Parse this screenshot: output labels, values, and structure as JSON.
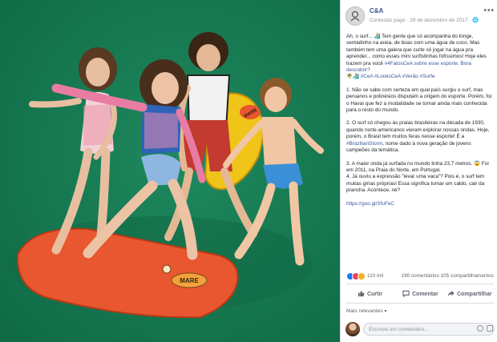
{
  "post": {
    "page_name": "C&A",
    "meta": "Conteúdo pago · 29 de dezembro de 2017 · 🌐",
    "more_label": "•••",
    "body": {
      "p1": "Ah, o surf... 🏄 Tem gente que só acompanha do longe, sentadinho na areia, de boas com uma água de coco. Mas também tem uma galera que curte só jogar na água pra aprender... como esses mini surfistinhas fofíssimos! Hoje eles trazem pra você",
      "p1_tag": "#4FatosCeA sobre esse esporte. Bora descobrir?",
      "p1_tags2": "🌴🏄 #CeA #LooksCeA #Verão #Surfe",
      "p2": "1. Não se sabe com certeza em qual país surgiu o surf, mas peruanos e polinésios disputam a origem do esporte. Porém, foi o Havaí que fez a modalidade se tornar ainda mais conhecida para o resto do mundo.",
      "p3a": "2. O surf só chegou às praias brasileiras na década de 1930, quando norte-americanos vieram explorar nossas ondas. Hoje, porém, o Brasil tem muitos feras nesse esporte! É a",
      "p3_tag": "#BrazilianStorm",
      "p3b": ", nome dado à nova geração de jovens campeões da temática.",
      "p4": "3. A maior onda já surfada no mundo tinha 23,7 metros. 😱 Foi em 2011, na Praia do Norte, em Portugal.",
      "p5": "4. Já ouviu a expressão \"levar uma vaca\"? Pois é, o surf tem muitas gírias próprias! Essa significa tomar um caldo, cair da prancha. Acontece, né?",
      "link": "https://goo.gl/XfuFeC"
    }
  },
  "reactions": {
    "count": "110 mil",
    "stats": "190 comentários  105 compartilhamentos"
  },
  "actions": {
    "like": "Curtir",
    "comment": "Comentar",
    "share": "Compartilhar"
  },
  "relevance": {
    "label": "Mais relevantes",
    "caret": "▾"
  },
  "comment_box": {
    "placeholder": "Escreva um comentário..."
  },
  "photo": {
    "board_front_brand": "MARE",
    "board_back_brand": "MARE"
  },
  "colors": {
    "background_green": "#177a52",
    "link_blue": "#385898",
    "board_orange": "#e8572f",
    "board_yellow": "#f0c419"
  }
}
